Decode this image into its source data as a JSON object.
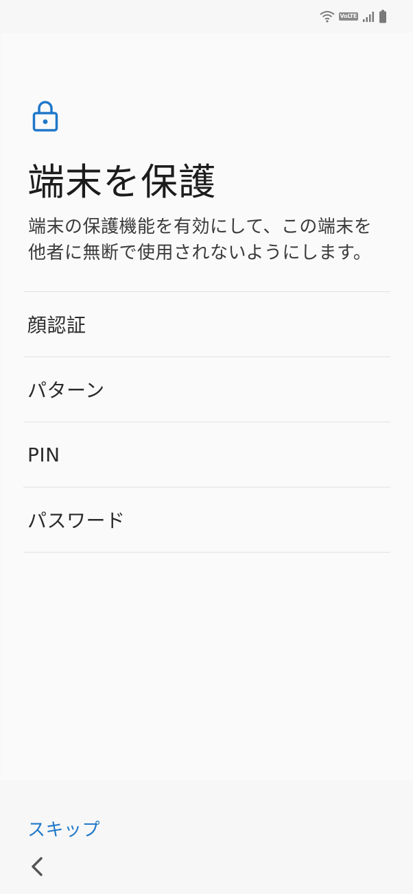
{
  "status_bar": {
    "icons": [
      "wifi-icon",
      "volte-badge",
      "cellular-signal-icon",
      "battery-icon"
    ],
    "volte_label": "VoLTE"
  },
  "header": {
    "icon": "lock-icon",
    "title": "端末を保護",
    "description": "端末の保護機能を有効にして、この端末を他者に無断で使用されないようにします。"
  },
  "options": [
    {
      "label": "顔認証"
    },
    {
      "label": "パターン"
    },
    {
      "label": "PIN"
    },
    {
      "label": "パスワード"
    }
  ],
  "footer": {
    "skip_label": "スキップ",
    "back_icon": "chevron-left-icon"
  },
  "colors": {
    "accent": "#1f77c9",
    "background": "#fafafa",
    "divider": "#e2e2e2"
  }
}
